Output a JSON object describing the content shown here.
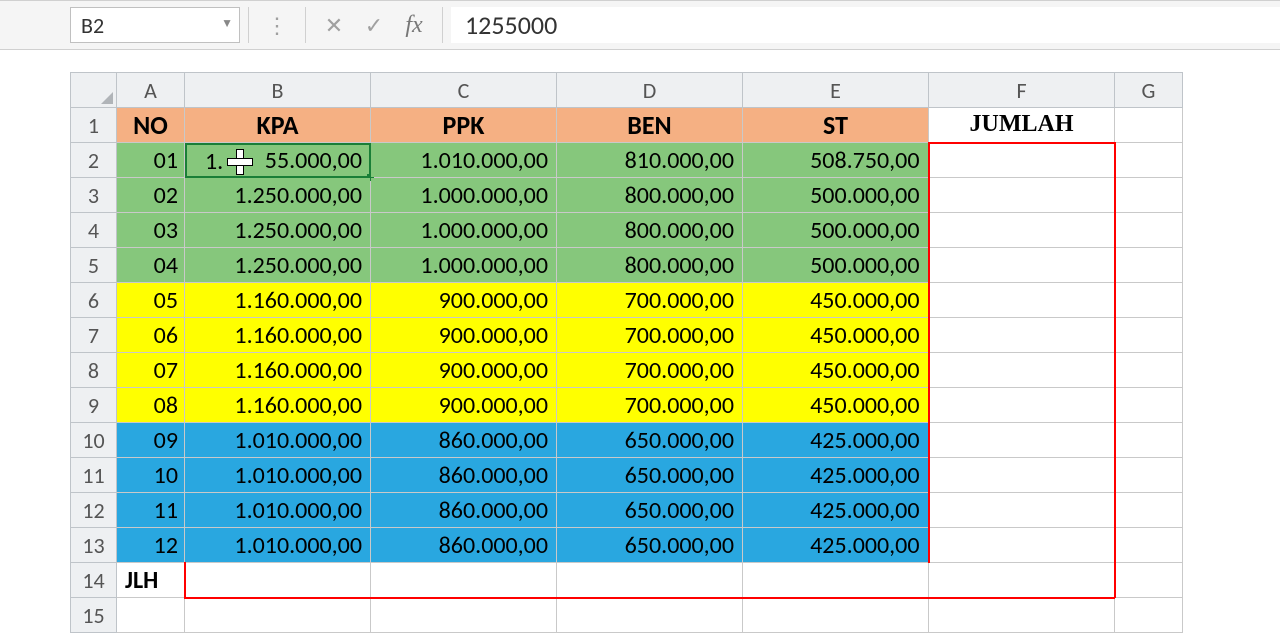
{
  "formula_bar": {
    "cell_ref": "B2",
    "value": "1255000"
  },
  "columns": [
    "A",
    "B",
    "C",
    "D",
    "E",
    "F",
    "G"
  ],
  "rowNumbers": [
    "1",
    "2",
    "3",
    "4",
    "5",
    "6",
    "7",
    "8",
    "9",
    "10",
    "11",
    "12",
    "13",
    "14",
    "15"
  ],
  "headers": {
    "A": "NO",
    "B": "KPA",
    "C": "PPK",
    "D": "BEN",
    "E": "ST",
    "F": "JUMLAH"
  },
  "rows": [
    {
      "no": "01",
      "b": "1.255.000,00",
      "c": "1.010.000,00",
      "d": "810.000,00",
      "e": "508.750,00",
      "cls": "green"
    },
    {
      "no": "02",
      "b": "1.250.000,00",
      "c": "1.000.000,00",
      "d": "800.000,00",
      "e": "500.000,00",
      "cls": "green"
    },
    {
      "no": "03",
      "b": "1.250.000,00",
      "c": "1.000.000,00",
      "d": "800.000,00",
      "e": "500.000,00",
      "cls": "green"
    },
    {
      "no": "04",
      "b": "1.250.000,00",
      "c": "1.000.000,00",
      "d": "800.000,00",
      "e": "500.000,00",
      "cls": "green"
    },
    {
      "no": "05",
      "b": "1.160.000,00",
      "c": "900.000,00",
      "d": "700.000,00",
      "e": "450.000,00",
      "cls": "yellow"
    },
    {
      "no": "06",
      "b": "1.160.000,00",
      "c": "900.000,00",
      "d": "700.000,00",
      "e": "450.000,00",
      "cls": "yellow"
    },
    {
      "no": "07",
      "b": "1.160.000,00",
      "c": "900.000,00",
      "d": "700.000,00",
      "e": "450.000,00",
      "cls": "yellow"
    },
    {
      "no": "08",
      "b": "1.160.000,00",
      "c": "900.000,00",
      "d": "700.000,00",
      "e": "450.000,00",
      "cls": "yellow"
    },
    {
      "no": "09",
      "b": "1.010.000,00",
      "c": "860.000,00",
      "d": "650.000,00",
      "e": "425.000,00",
      "cls": "blue"
    },
    {
      "no": "10",
      "b": "1.010.000,00",
      "c": "860.000,00",
      "d": "650.000,00",
      "e": "425.000,00",
      "cls": "blue"
    },
    {
      "no": "11",
      "b": "1.010.000,00",
      "c": "860.000,00",
      "d": "650.000,00",
      "e": "425.000,00",
      "cls": "blue"
    },
    {
      "no": "12",
      "b": "1.010.000,00",
      "c": "860.000,00",
      "d": "650.000,00",
      "e": "425.000,00",
      "cls": "blue"
    }
  ],
  "footer_label": "JLH",
  "active_cell_display": "55.000,00"
}
